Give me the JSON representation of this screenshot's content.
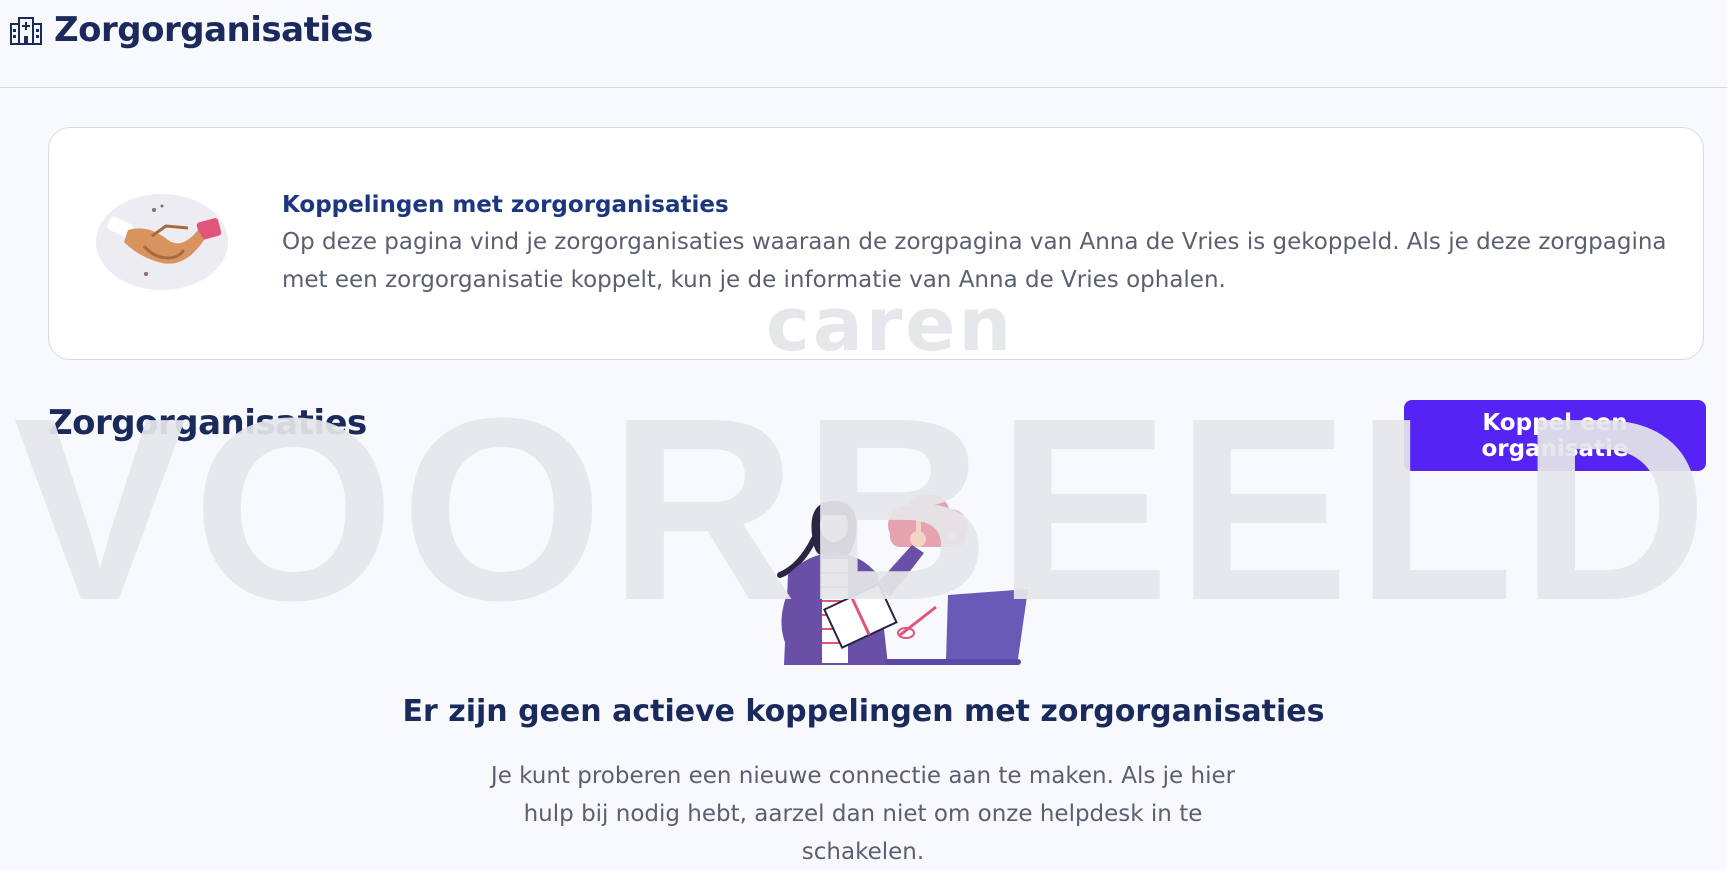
{
  "header": {
    "title": "Zorgorganisaties",
    "icon": "hospital-icon"
  },
  "info_card": {
    "title": "Koppelingen met zorgorganisaties",
    "text": "Op deze pagina vind je zorgorganisaties waaraan de zorgpagina van Anna de Vries is gekoppeld. Als je deze zorgpagina met een zorgorganisatie koppelt, kun je de informatie van Anna de Vries ophalen.",
    "illustration": "handshake-icon"
  },
  "watermark": {
    "logo": "caren",
    "text": "VOORBEELD"
  },
  "section": {
    "title": "Zorgorganisaties",
    "button_label": "Koppel een organisatie"
  },
  "empty_state": {
    "title": "Er zijn geen actieve koppelingen met zorgorganisaties",
    "text": "Je kunt proberen een nieuwe connectie aan te maken. Als je hier hulp bij nodig hebt, aarzel dan niet om onze helpdesk in te schakelen.",
    "illustration": "woman-with-laptop-illustration"
  },
  "colors": {
    "primary": "#5524f5",
    "heading": "#1b2a5c",
    "background": "#f8f9fc"
  }
}
